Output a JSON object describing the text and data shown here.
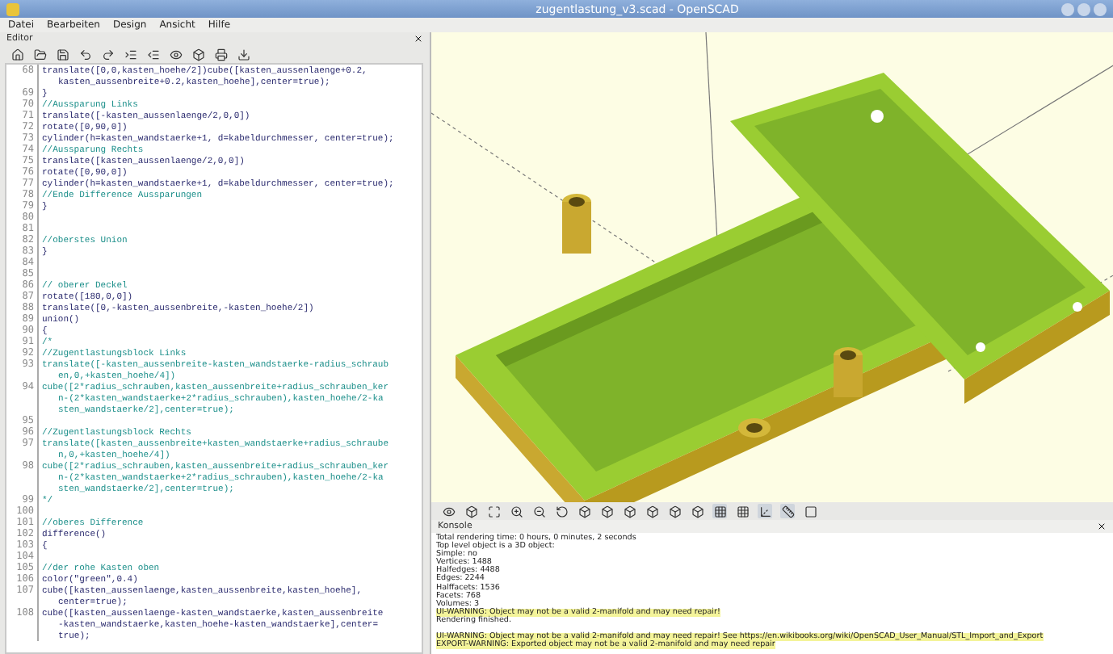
{
  "window": {
    "title": "zugentlastung_v3.scad - OpenSCAD"
  },
  "menu": [
    "Datei",
    "Bearbeiten",
    "Design",
    "Ansicht",
    "Hilfe"
  ],
  "editor": {
    "title": "Editor",
    "lines": [
      {
        "number": "68",
        "kind": "code",
        "segments": [
          "translate([0,0,kasten_hoehe/2])cube([kasten_aussenlaenge+0.2,",
          "kasten_aussenbreite+0.2,kasten_hoehe],center=true);"
        ]
      },
      {
        "number": "69",
        "kind": "code",
        "segments": [
          "}"
        ]
      },
      {
        "number": "70",
        "kind": "comment",
        "segments": [
          "//Aussparung Links"
        ]
      },
      {
        "number": "71",
        "kind": "code",
        "segments": [
          "translate([-kasten_aussenlaenge/2,0,0])"
        ]
      },
      {
        "number": "72",
        "kind": "code",
        "segments": [
          "rotate([0,90,0])"
        ]
      },
      {
        "number": "73",
        "kind": "code",
        "segments": [
          "cylinder(h=kasten_wandstaerke+1, d=kabeldurchmesser, center=true);"
        ]
      },
      {
        "number": "74",
        "kind": "comment",
        "segments": [
          "//Aussparung Rechts"
        ]
      },
      {
        "number": "75",
        "kind": "code",
        "segments": [
          "translate([kasten_aussenlaenge/2,0,0])"
        ]
      },
      {
        "number": "76",
        "kind": "code",
        "segments": [
          "rotate([0,90,0])"
        ]
      },
      {
        "number": "77",
        "kind": "code",
        "segments": [
          "cylinder(h=kasten_wandstaerke+1, d=kabeldurchmesser, center=true);"
        ]
      },
      {
        "number": "78",
        "kind": "comment",
        "segments": [
          "//Ende Difference Aussparungen"
        ]
      },
      {
        "number": "79",
        "kind": "code",
        "segments": [
          "}"
        ]
      },
      {
        "number": "80",
        "kind": "code"
      },
      {
        "number": "81",
        "kind": "code"
      },
      {
        "number": "82",
        "kind": "comment",
        "segments": [
          "//oberstes Union"
        ]
      },
      {
        "number": "83",
        "kind": "code",
        "segments": [
          "}"
        ]
      },
      {
        "number": "84",
        "kind": "code"
      },
      {
        "number": "85",
        "kind": "code"
      },
      {
        "number": "86",
        "kind": "comment",
        "segments": [
          "// oberer Deckel"
        ]
      },
      {
        "number": "87",
        "kind": "code",
        "segments": [
          "rotate([180,0,0])"
        ]
      },
      {
        "number": "88",
        "kind": "code",
        "segments": [
          "translate([0,-kasten_aussenbreite,-kasten_hoehe/2])"
        ]
      },
      {
        "number": "89",
        "kind": "code",
        "segments": [
          "union()"
        ]
      },
      {
        "number": "90",
        "kind": "code",
        "segments": [
          "{"
        ]
      },
      {
        "number": "91",
        "kind": "comment",
        "segments": [
          "/*"
        ]
      },
      {
        "number": "92",
        "kind": "comment",
        "segments": [
          "//Zugentlastungsblock Links"
        ]
      },
      {
        "number": "93",
        "kind": "comment",
        "segments": [
          "translate([-kasten_aussenbreite-kasten_wandstaerke-radius_schraub",
          "en,0,+kasten_hoehe/4])"
        ]
      },
      {
        "number": "94",
        "kind": "comment",
        "segments": [
          "cube([2*radius_schrauben,kasten_aussenbreite+radius_schrauben_ker",
          "n-(2*kasten_wandstaerke+2*radius_schrauben),kasten_hoehe/2-ka",
          "sten_wandstaerke/2],center=true);"
        ]
      },
      {
        "number": "95",
        "kind": "comment"
      },
      {
        "number": "96",
        "kind": "comment",
        "segments": [
          "//Zugentlastungsblock Rechts"
        ]
      },
      {
        "number": "97",
        "kind": "comment",
        "segments": [
          "translate([kasten_aussenbreite+kasten_wandstaerke+radius_schraube",
          "n,0,+kasten_hoehe/4])"
        ]
      },
      {
        "number": "98",
        "kind": "comment",
        "segments": [
          "cube([2*radius_schrauben,kasten_aussenbreite+radius_schrauben_ker",
          "n-(2*kasten_wandstaerke+2*radius_schrauben),kasten_hoehe/2-ka",
          "sten_wandstaerke/2],center=true);"
        ]
      },
      {
        "number": "99",
        "kind": "comment",
        "segments": [
          "*/"
        ]
      },
      {
        "number": "100",
        "kind": "code"
      },
      {
        "number": "101",
        "kind": "comment",
        "segments": [
          "//oberes Difference"
        ]
      },
      {
        "number": "102",
        "kind": "code",
        "segments": [
          "difference()"
        ]
      },
      {
        "number": "103",
        "kind": "code",
        "segments": [
          "{"
        ]
      },
      {
        "number": "104",
        "kind": "code"
      },
      {
        "number": "105",
        "kind": "comment",
        "segments": [
          "//der rohe Kasten oben"
        ]
      },
      {
        "number": "106",
        "kind": "code",
        "segments": [
          "color(\"green\",0.4)"
        ]
      },
      {
        "number": "107",
        "kind": "code",
        "segments": [
          "cube([kasten_aussenlaenge,kasten_aussenbreite,kasten_hoehe],",
          "center=true);"
        ]
      },
      {
        "number": "108",
        "kind": "code",
        "segments": [
          "cube([kasten_aussenlaenge-kasten_wandstaerke,kasten_aussenbreite",
          "-kasten_wandstaerke,kasten_hoehe-kasten_wandstaerke],center=",
          "true);"
        ]
      }
    ]
  },
  "console": {
    "title": "Konsole",
    "lines": [
      {
        "kind": "normal",
        "text": "Total rendering time: 0 hours, 0 minutes, 2 seconds"
      },
      {
        "kind": "normal",
        "text": "Top level object is a 3D object:"
      },
      {
        "kind": "normal",
        "text": "Simple: no"
      },
      {
        "kind": "normal",
        "text": "Vertices: 1488"
      },
      {
        "kind": "normal",
        "text": "Halfedges: 4488"
      },
      {
        "kind": "normal",
        "text": "Edges: 2244"
      },
      {
        "kind": "normal",
        "text": "Halffacets: 1536"
      },
      {
        "kind": "normal",
        "text": "Facets: 768"
      },
      {
        "kind": "normal",
        "text": "Volumes: 3"
      },
      {
        "kind": "warning",
        "text": "UI-WARNING: Object may not be a valid 2-manifold and may need repair!"
      },
      {
        "kind": "normal",
        "text": "Rendering finished."
      },
      {
        "kind": "blank"
      },
      {
        "kind": "warning",
        "text": "UI-WARNING: Object may not be a valid 2-manifold and may need repair! See https://en.wikibooks.org/wiki/OpenSCAD_User_Manual/STL_Import_and_Export"
      },
      {
        "kind": "warning",
        "text": "EXPORT-WARNING: Exported object may not be a valid 2-manifold and may need repair"
      }
    ]
  }
}
